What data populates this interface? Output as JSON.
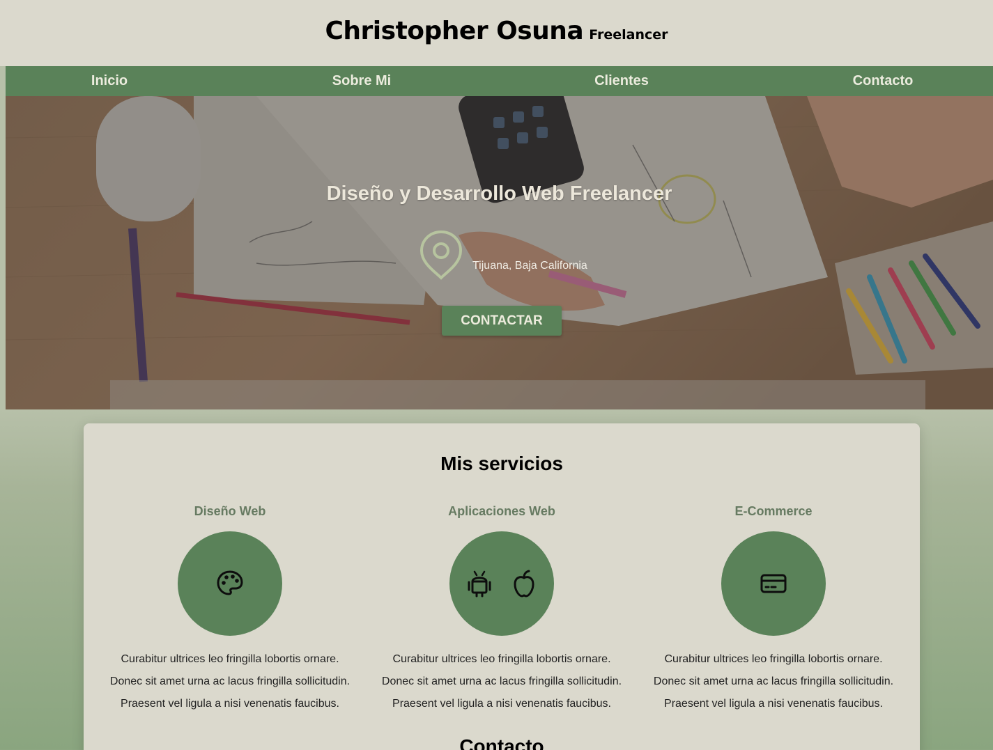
{
  "header": {
    "name": "Christopher Osuna",
    "subtitle": "Freelancer"
  },
  "nav": {
    "items": [
      {
        "label": "Inicio"
      },
      {
        "label": "Sobre Mi"
      },
      {
        "label": "Clientes"
      },
      {
        "label": "Contacto"
      }
    ]
  },
  "hero": {
    "title": "Diseño y Desarrollo Web Freelancer",
    "location": "Tijuana, Baja California",
    "button_label": "CONTACTAR"
  },
  "services": {
    "title": "Mis servicios",
    "items": [
      {
        "title": "Diseño Web",
        "icon": "palette-icon",
        "lines": [
          "Curabitur ultrices leo fringilla lobortis ornare.",
          "Donec sit amet urna ac lacus fringilla sollicitudin.",
          "Praesent vel ligula a nisi venenatis faucibus."
        ]
      },
      {
        "title": "Aplicaciones Web",
        "icon": "android-and-apple-icons",
        "lines": [
          "Curabitur ultrices leo fringilla lobortis ornare.",
          "Donec sit amet urna ac lacus fringilla sollicitudin.",
          "Praesent vel ligula a nisi venenatis faucibus."
        ]
      },
      {
        "title": "E-Commerce",
        "icon": "credit-card-icon",
        "lines": [
          "Curabitur ultrices leo fringilla lobortis ornare.",
          "Donec sit amet urna ac lacus fringilla sollicitudin.",
          "Praesent vel ligula a nisi venenatis faucibus."
        ]
      }
    ]
  },
  "next_section": {
    "title": "Contacto"
  },
  "colors": {
    "primary_green": "#5a8259",
    "beige": "#dbd9cd",
    "service_title": "#667a61"
  }
}
